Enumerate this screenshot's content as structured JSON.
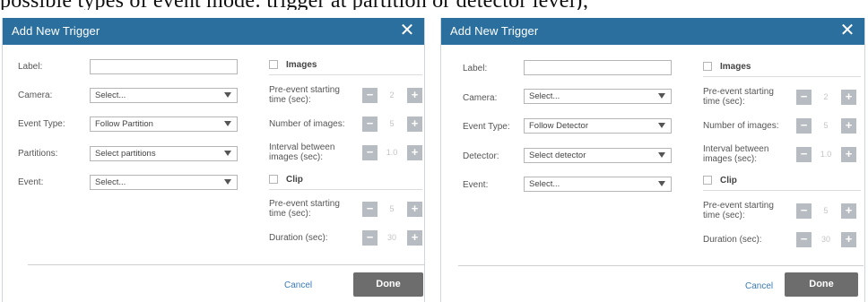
{
  "top_strip": {
    "text": "possible types of event mode: trigger at partition or detector level);"
  },
  "dialogs": [
    {
      "title": "Add New Trigger",
      "close_icon": "close-icon",
      "left": {
        "label_label": "Label:",
        "label_value": "",
        "camera_label": "Camera:",
        "camera_value": "Select...",
        "event_type_label": "Event Type:",
        "event_type_value": "Follow Partition",
        "source_label": "Partitions:",
        "source_value": "Select partitions",
        "event_label": "Event:",
        "event_value": "Select..."
      },
      "images": {
        "title": "Images",
        "pre_event_label": "Pre-event starting time (sec):",
        "pre_event_value": "2",
        "num_images_label": "Number of images:",
        "num_images_value": "5",
        "interval_label": "Interval between images (sec):",
        "interval_value": "1.0"
      },
      "clip": {
        "title": "Clip",
        "pre_event_label": "Pre-event starting time (sec):",
        "pre_event_value": "5",
        "duration_label": "Duration (sec):",
        "duration_value": "30"
      },
      "footer": {
        "cancel": "Cancel",
        "done": "Done"
      }
    },
    {
      "title": "Add New Trigger",
      "close_icon": "close-icon",
      "left": {
        "label_label": "Label:",
        "label_value": "",
        "camera_label": "Camera:",
        "camera_value": "Select...",
        "event_type_label": "Event Type:",
        "event_type_value": "Follow Detector",
        "source_label": "Detector:",
        "source_value": "Select detector",
        "event_label": "Event:",
        "event_value": "Select..."
      },
      "images": {
        "title": "Images",
        "pre_event_label": "Pre-event starting time (sec):",
        "pre_event_value": "2",
        "num_images_label": "Number of images:",
        "num_images_value": "5",
        "interval_label": "Interval between images (sec):",
        "interval_value": "1.0"
      },
      "clip": {
        "title": "Clip",
        "pre_event_label": "Pre-event starting time (sec):",
        "pre_event_value": "5",
        "duration_label": "Duration (sec):",
        "duration_value": "30"
      },
      "footer": {
        "cancel": "Cancel",
        "done": "Done"
      }
    }
  ],
  "colors": {
    "header": "#2a6f9e",
    "done_button": "#6d6d6d",
    "stepper": "#b6bcc2",
    "link": "#3a7ab8"
  },
  "icons": {
    "minus": "minus-icon",
    "plus": "plus-icon",
    "close": "close-icon",
    "caret": "chevron-down-icon"
  }
}
